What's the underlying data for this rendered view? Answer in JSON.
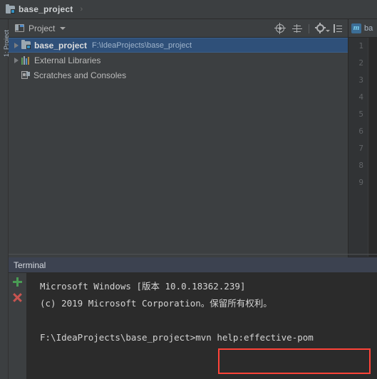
{
  "navbar": {
    "crumb_label": "base_project",
    "crumb_icon": "module-folder-icon",
    "separator": "›"
  },
  "left_strip": {
    "tabs": [
      {
        "label": "1: Project",
        "name": "tool-tab-project"
      }
    ]
  },
  "project_panel": {
    "title": "Project",
    "title_icon": "project-window-icon",
    "dropdown_icon": "chevron-down-icon",
    "actions": [
      {
        "name": "locate-icon",
        "label": "Select Opened File"
      },
      {
        "name": "collapse-all-icon",
        "label": "Collapse All"
      },
      {
        "name": "settings-gear-icon",
        "label": "Settings"
      },
      {
        "name": "hide-panel-icon",
        "label": "Hide"
      }
    ],
    "tree": [
      {
        "label": "base_project",
        "sub": "F:\\IdeaProjects\\base_project",
        "icon": "module-folder-icon",
        "expandable": true,
        "selected": true,
        "indent": 0
      },
      {
        "label": "External Libraries",
        "sub": "",
        "icon": "libraries-books-icon",
        "expandable": true,
        "selected": false,
        "indent": 0
      },
      {
        "label": "Scratches and Consoles",
        "sub": "",
        "icon": "scratches-icon",
        "expandable": false,
        "selected": false,
        "indent": 0
      }
    ]
  },
  "editor": {
    "tab_icon": "maven-icon",
    "tab_icon_glyph": "m",
    "tab_label": "ba",
    "line_numbers": [
      "1",
      "2",
      "3",
      "4",
      "5",
      "6",
      "7",
      "8",
      "9"
    ]
  },
  "terminal": {
    "title": "Terminal",
    "actions": [
      {
        "name": "new-session-plus-icon",
        "label": "New Session"
      },
      {
        "name": "close-session-icon",
        "label": "Close Session"
      }
    ],
    "lines": [
      "Microsoft Windows [版本 10.0.18362.239]",
      "(c) 2019 Microsoft Corporation。保留所有权利。",
      "",
      ""
    ],
    "prompt": "F:\\IdeaProjects\\base_project>",
    "command": "mvn help:effective-pom",
    "highlight_color": "#ff4338"
  },
  "colors": {
    "window_bg": "#3c3f41",
    "console_bg": "#2b2b2b",
    "selection_blue": "#2f5079",
    "terminal_header": "#3c4250",
    "accent_red": "#ff4338",
    "accent_green": "#499c54"
  }
}
